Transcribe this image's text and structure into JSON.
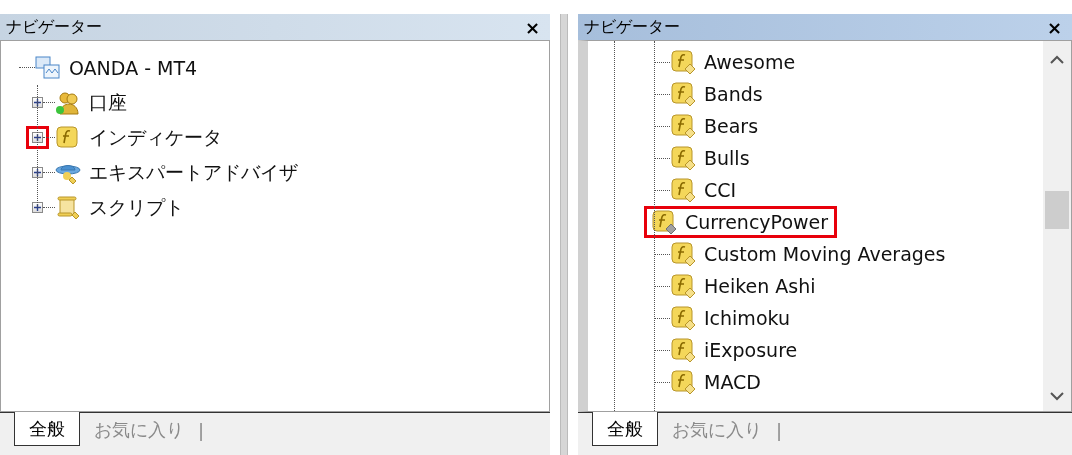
{
  "panels": [
    {
      "title": "ナビゲーター",
      "close": "×",
      "tree": [
        {
          "label": "OANDA - MT4",
          "kind": "terminal",
          "children": [
            {
              "label": "口座",
              "kind": "accounts",
              "expanded": false,
              "highlighted": false
            },
            {
              "label": "インディケータ",
              "kind": "indicator-folder",
              "expanded": false,
              "highlighted": true
            },
            {
              "label": "エキスパートアドバイザ",
              "kind": "expert",
              "expanded": false,
              "highlighted": false
            },
            {
              "label": "スクリプト",
              "kind": "script",
              "expanded": false,
              "highlighted": false
            }
          ]
        }
      ],
      "tabs": [
        {
          "label": "全般",
          "selected": true
        },
        {
          "label": "お気に入り",
          "selected": false
        }
      ],
      "tab_separator": "|"
    },
    {
      "title": "ナビゲーター",
      "close": "×",
      "items": [
        {
          "label": "Awesome",
          "kind": "indicator",
          "highlighted": false
        },
        {
          "label": "Bands",
          "kind": "indicator",
          "highlighted": false
        },
        {
          "label": "Bears",
          "kind": "indicator",
          "highlighted": false
        },
        {
          "label": "Bulls",
          "kind": "indicator",
          "highlighted": false
        },
        {
          "label": "CCI",
          "kind": "indicator",
          "highlighted": false
        },
        {
          "label": "CurrencyPower",
          "kind": "custom-indicator",
          "highlighted": true
        },
        {
          "label": "Custom Moving Averages",
          "kind": "indicator",
          "highlighted": false
        },
        {
          "label": "Heiken Ashi",
          "kind": "indicator",
          "highlighted": false
        },
        {
          "label": "Ichimoku",
          "kind": "indicator",
          "highlighted": false
        },
        {
          "label": "iExposure",
          "kind": "indicator",
          "highlighted": false
        },
        {
          "label": "MACD",
          "kind": "indicator",
          "highlighted": false
        }
      ],
      "tabs": [
        {
          "label": "全般",
          "selected": true
        },
        {
          "label": "お気に入り",
          "selected": false
        }
      ],
      "tab_separator": "|"
    }
  ]
}
